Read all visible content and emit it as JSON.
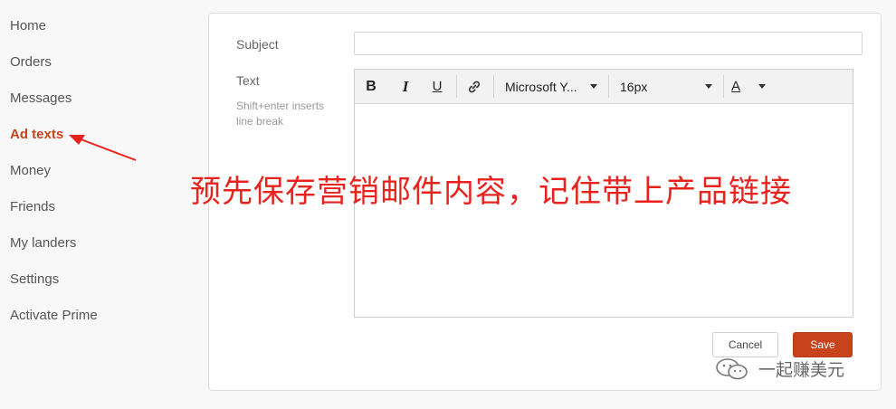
{
  "sidebar": {
    "items": [
      {
        "label": "Home",
        "active": false
      },
      {
        "label": "Orders",
        "active": false
      },
      {
        "label": "Messages",
        "active": false
      },
      {
        "label": "Ad texts",
        "active": true
      },
      {
        "label": "Money",
        "active": false
      },
      {
        "label": "Friends",
        "active": false
      },
      {
        "label": "My landers",
        "active": false
      },
      {
        "label": "Settings",
        "active": false
      },
      {
        "label": "Activate Prime",
        "active": false
      }
    ]
  },
  "form": {
    "subject_label": "Subject",
    "subject_value": "",
    "text_label": "Text",
    "text_hint": "Shift+enter inserts line break",
    "toolbar": {
      "bold": "B",
      "italic": "I",
      "underline": "U",
      "font_family": "Microsoft Y...",
      "font_size": "16px",
      "text_color_letter": "A"
    },
    "cancel_label": "Cancel",
    "save_label": "Save"
  },
  "annotation": {
    "text": "预先保存营销邮件内容，记住带上产品链接"
  },
  "watermark": {
    "text": "一起赚美元"
  },
  "colors": {
    "accent": "#c8431b",
    "annotation_red": "#e8231e"
  }
}
